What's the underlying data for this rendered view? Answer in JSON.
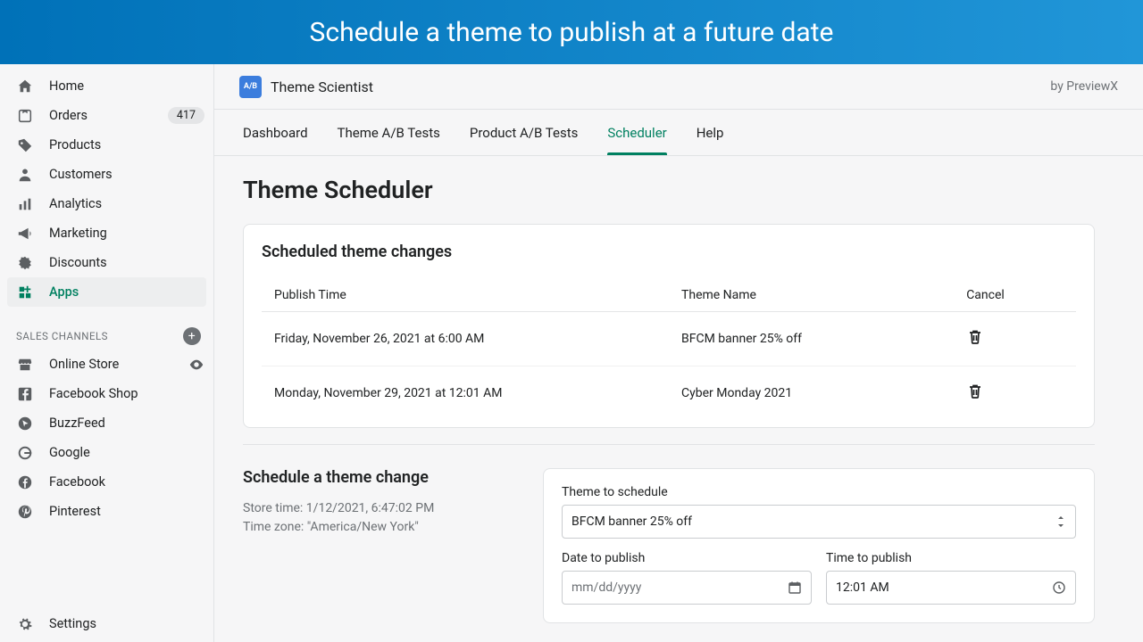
{
  "banner": {
    "headline": "Schedule a theme to publish at a future date"
  },
  "sidebar": {
    "nav": [
      {
        "label": "Home",
        "icon": "home"
      },
      {
        "label": "Orders",
        "icon": "orders",
        "badge": "417"
      },
      {
        "label": "Products",
        "icon": "products"
      },
      {
        "label": "Customers",
        "icon": "customers"
      },
      {
        "label": "Analytics",
        "icon": "analytics"
      },
      {
        "label": "Marketing",
        "icon": "marketing"
      },
      {
        "label": "Discounts",
        "icon": "discounts"
      },
      {
        "label": "Apps",
        "icon": "apps",
        "active": true
      }
    ],
    "channels_header": "SALES CHANNELS",
    "channels": [
      {
        "label": "Online Store",
        "icon": "store",
        "eye": true
      },
      {
        "label": "Facebook Shop",
        "icon": "fb-square"
      },
      {
        "label": "BuzzFeed",
        "icon": "buzzfeed"
      },
      {
        "label": "Google",
        "icon": "google"
      },
      {
        "label": "Facebook",
        "icon": "fb-circle"
      },
      {
        "label": "Pinterest",
        "icon": "pinterest"
      }
    ],
    "settings_label": "Settings"
  },
  "appbar": {
    "title": "Theme Scientist",
    "by_line": "by PreviewX"
  },
  "tabs": {
    "items": [
      "Dashboard",
      "Theme A/B Tests",
      "Product A/B Tests",
      "Scheduler",
      "Help"
    ],
    "active_index": 3
  },
  "page": {
    "title": "Theme Scheduler"
  },
  "scheduled": {
    "heading": "Scheduled theme changes",
    "columns": {
      "publish": "Publish Time",
      "theme": "Theme Name",
      "cancel": "Cancel"
    },
    "rows": [
      {
        "publish": "Friday, November 26, 2021 at 6:00 AM",
        "theme": "BFCM banner 25% off"
      },
      {
        "publish": "Monday, November 29, 2021 at 12:01 AM",
        "theme": "Cyber Monday 2021"
      }
    ]
  },
  "form": {
    "heading": "Schedule a theme change",
    "store_time": "Store time: 1/12/2021, 6:47:02 PM",
    "time_zone": "Time zone: \"America/New York\"",
    "theme_label": "Theme to schedule",
    "theme_value": "BFCM banner 25% off",
    "date_label": "Date to publish",
    "date_placeholder": "mm/dd/yyyy",
    "time_label": "Time to publish",
    "time_value": "12:01 AM"
  }
}
